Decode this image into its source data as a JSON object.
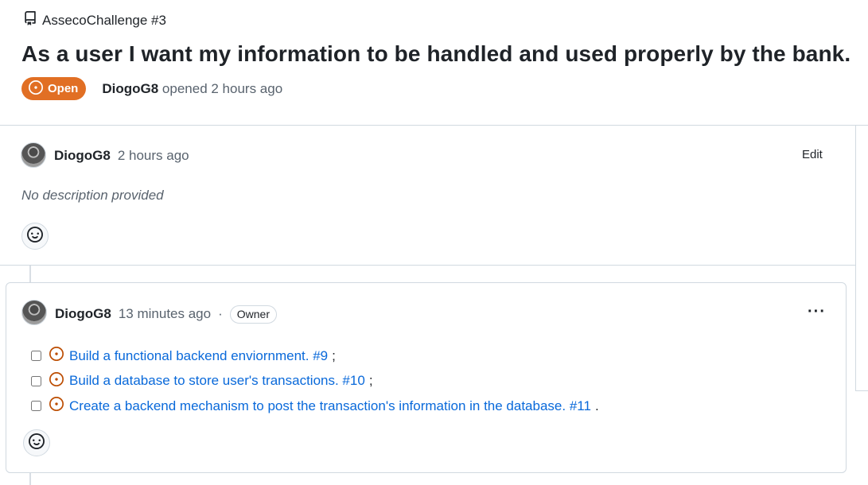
{
  "header": {
    "repo_ref": "AssecoChallenge #3",
    "title": "As a user I want my information to be handled and used properly by the bank.",
    "state": "Open",
    "author": "DiogoG8",
    "opened_text": "opened 2 hours ago"
  },
  "description": {
    "author": "DiogoG8",
    "time": "2 hours ago",
    "edit_label": "Edit",
    "body": "No description provided"
  },
  "comment": {
    "author": "DiogoG8",
    "time": "13 minutes ago",
    "separator": "·",
    "role_badge": "Owner",
    "menu": "···",
    "tasks": [
      {
        "text": "Build a functional backend enviornment. #9",
        "suffix": ";",
        "checked": false
      },
      {
        "text": "Build a database to store user's transactions. #10",
        "suffix": ";",
        "checked": false
      },
      {
        "text": "Create a backend mechanism to post the transaction's information in the database. #11",
        "suffix": ".",
        "checked": false
      }
    ]
  },
  "colors": {
    "open_badge": "#e16f24",
    "link": "#0969da",
    "muted": "#59636e"
  }
}
